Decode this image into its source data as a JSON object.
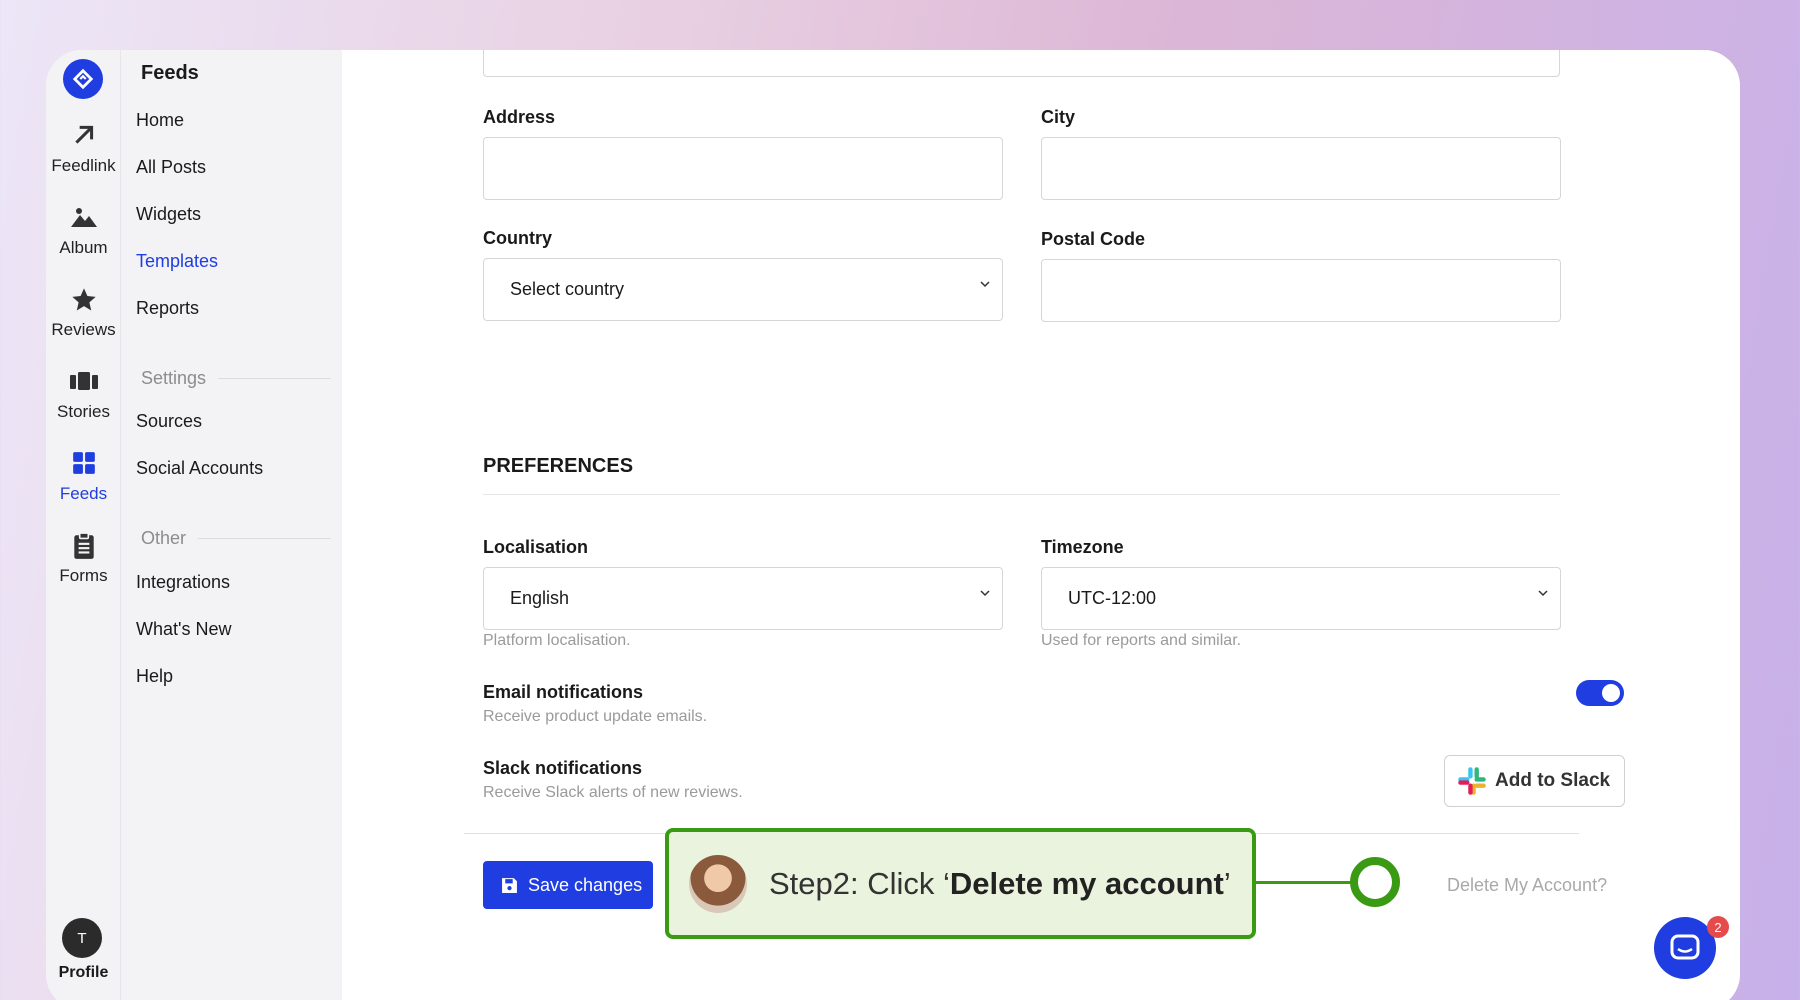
{
  "nav_rail": {
    "items": [
      {
        "label": "Feedlink",
        "icon": "arrow-up-right-icon"
      },
      {
        "label": "Album",
        "icon": "mountain-image-icon"
      },
      {
        "label": "Reviews",
        "icon": "star-icon"
      },
      {
        "label": "Stories",
        "icon": "stories-cards-icon"
      },
      {
        "label": "Feeds",
        "icon": "grid-icon",
        "active": true
      },
      {
        "label": "Forms",
        "icon": "clipboard-icon"
      }
    ],
    "avatar_initial": "T",
    "profile_label": "Profile"
  },
  "sidebar": {
    "title": "Feeds",
    "items": [
      "Home",
      "All Posts",
      "Widgets",
      "Templates",
      "Reports"
    ],
    "active_item": "Templates",
    "settings_section": "Settings",
    "settings_items": [
      "Sources",
      "Social Accounts"
    ],
    "other_section": "Other",
    "other_items": [
      "Integrations",
      "What's New",
      "Help"
    ]
  },
  "form": {
    "address_label": "Address",
    "address_value": "",
    "city_label": "City",
    "city_value": "",
    "country_label": "Country",
    "country_value": "Select country",
    "postal_label": "Postal Code",
    "postal_value": ""
  },
  "preferences": {
    "title": "PREFERENCES",
    "localisation_label": "Localisation",
    "localisation_value": "English",
    "localisation_help": "Platform localisation.",
    "timezone_label": "Timezone",
    "timezone_value": "UTC-12:00",
    "timezone_help": "Used for reports and similar.",
    "email_label": "Email notifications",
    "email_help": "Receive product update emails.",
    "email_enabled": true,
    "slack_label": "Slack notifications",
    "slack_help": "Receive Slack alerts of new reviews.",
    "slack_button": "Add to Slack"
  },
  "actions": {
    "save_label": "Save changes",
    "delete_label": "Delete My Account?"
  },
  "callout": {
    "prefix": "Step2: Click ‘",
    "bold": "Delete my account",
    "suffix": "’"
  },
  "chat": {
    "badge_count": "2"
  },
  "colors": {
    "accent": "#1f3de0",
    "callout_green": "#3a9a14",
    "callout_bg": "#e9f3dd"
  }
}
